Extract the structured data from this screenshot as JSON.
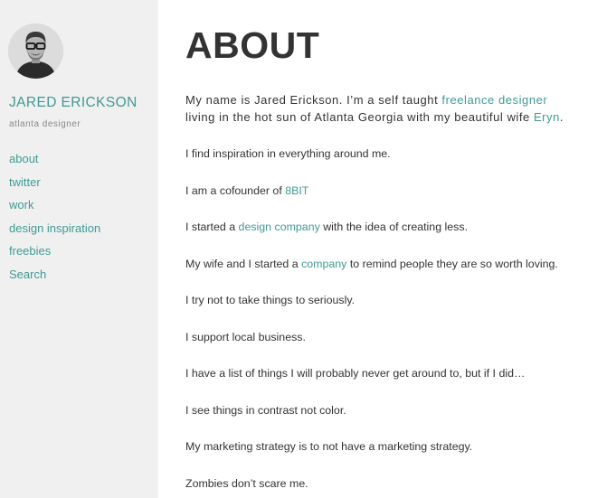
{
  "sidebar": {
    "name": "JARED ERICKSON",
    "tagline": "atlanta designer",
    "nav": [
      "about",
      "twitter",
      "work",
      "design inspiration",
      "freebies",
      "Search"
    ]
  },
  "main": {
    "title": "ABOUT",
    "intro": {
      "part1": "My name is Jared Erickson. I’m a self taught ",
      "link1": "freelance designer",
      "part2": "living in the hot sun of Atlanta Georgia with my beautiful wife ",
      "link2": "Eryn",
      "part3": "."
    },
    "paragraphs": [
      {
        "before": "I find inspiration in everything around me.",
        "link": "",
        "after": ""
      },
      {
        "before": "I am a cofounder of ",
        "link": "8BIT",
        "after": ""
      },
      {
        "before": "I started a ",
        "link": "design company",
        "after": " with the idea of creating less."
      },
      {
        "before": "My wife and I started a ",
        "link": "company",
        "after": " to remind people they are so worth loving."
      },
      {
        "before": "I try not to take things to seriously.",
        "link": "",
        "after": ""
      },
      {
        "before": "I support local business.",
        "link": "",
        "after": ""
      },
      {
        "before": "I have a list of things I will probably never get around to, but if I did…",
        "link": "",
        "after": ""
      },
      {
        "before": "I see things in contrast not color.",
        "link": "",
        "after": ""
      },
      {
        "before": "My marketing strategy is to not have a marketing strategy.",
        "link": "",
        "after": ""
      },
      {
        "before": "Zombies don’t scare me.",
        "link": "",
        "after": ""
      }
    ]
  },
  "colors": {
    "accent": "#3e9b94",
    "sidebar_bg": "#f0f0f0",
    "text": "#333333",
    "muted": "#888888"
  }
}
